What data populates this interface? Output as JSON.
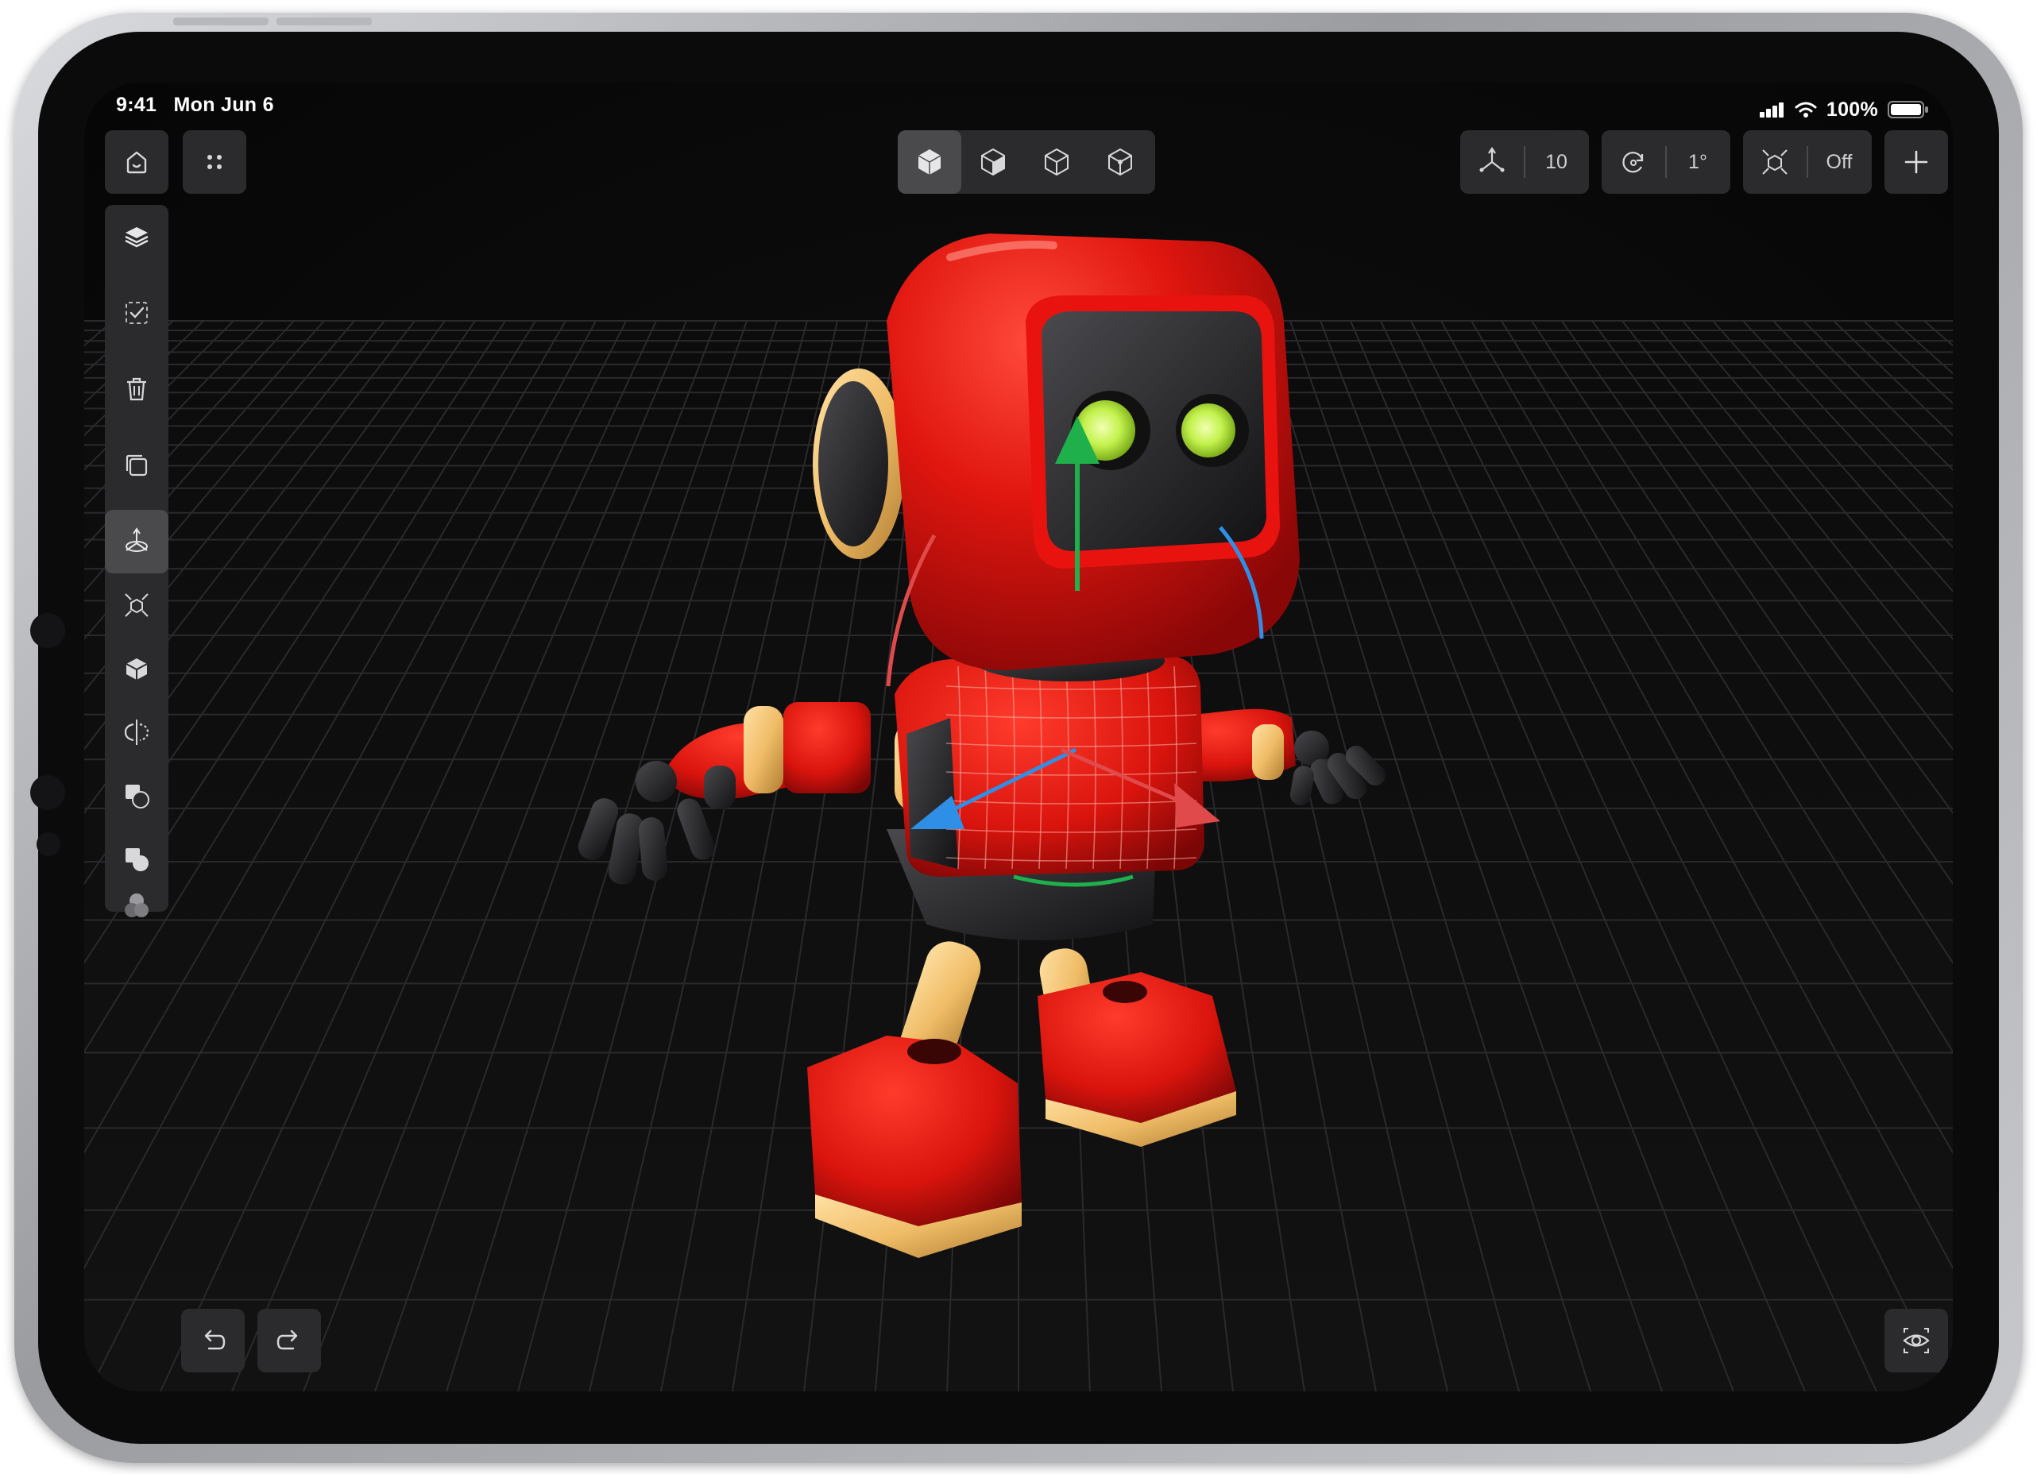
{
  "status_bar": {
    "time": "9:41",
    "date": "Mon Jun 6",
    "battery": "100%"
  },
  "toolbar": {
    "move_snap_value": "10",
    "rotate_snap_value": "1°",
    "scale_snap_value": "Off"
  },
  "view_modes": [
    "solid-view-icon",
    "material-view-icon",
    "wireframe-view-icon",
    "point-view-icon"
  ],
  "left_tools": [
    "layers-icon",
    "select-icon",
    "trash-icon",
    "duplicate-icon",
    "transform-icon",
    "scale-icon",
    "extrude-icon",
    "mirror-icon",
    "boolean-subtract-icon",
    "boolean-union-icon",
    "boolean-intersect-icon"
  ],
  "colors": {
    "accent_red": "#e01b1b",
    "gizmo_green": "#1fb04c",
    "gizmo_blue": "#2f8fe6",
    "gizmo_red": "#e04a4a",
    "eye_glow": "#c8f55a",
    "gold": "#f0c272"
  }
}
